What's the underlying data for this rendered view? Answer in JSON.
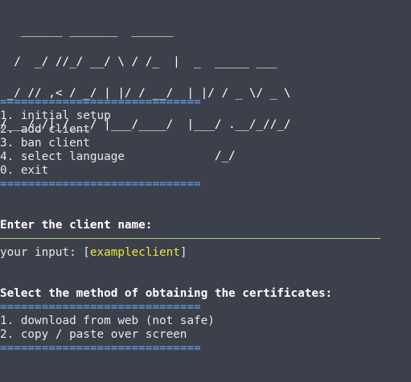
{
  "banner": {
    "lines": [
      "   ______ _______  ______",
      "  /  _/ //_/ __/ \\ / /_  |  _  _____ ___",
      " _/ // ,< / _/ | |/ / __/  | |/ / _ \\/ _ \\",
      "/___/_/|_/___/ |___/____/  |___/ .__/_//_/",
      "                               /_/"
    ]
  },
  "separator": "=============================",
  "main_menu": {
    "items": [
      "1. initial setup",
      "2. add client",
      "3. ban client",
      "4. select language",
      "0. exit"
    ]
  },
  "client_prompt": {
    "title": "Enter the client name:",
    "input_label": "your input: ",
    "bracket_open": "[",
    "input_value": "exampleclient",
    "bracket_close": "]"
  },
  "cert_menu": {
    "title": "Select the method of obtaining the certificates:",
    "items": [
      "1. download from web (not safe)",
      "2. copy / paste over screen"
    ]
  },
  "colors": {
    "background": "#3c404b",
    "text": "#e8e8e8",
    "separator": "#6aa4f0",
    "highlight": "#e8e83c",
    "rule": "#a8d47a"
  }
}
